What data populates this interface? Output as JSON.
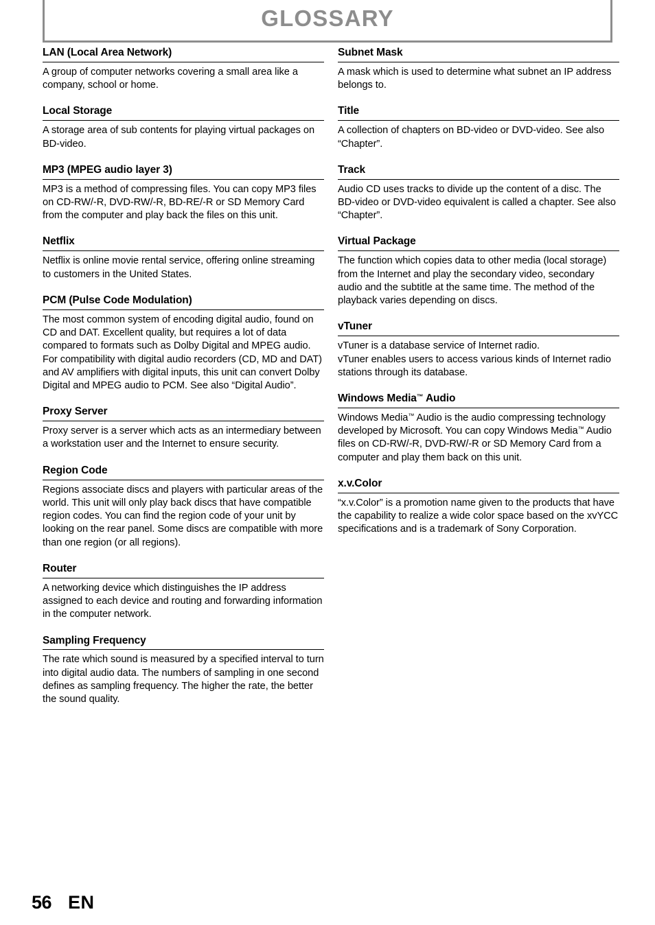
{
  "header": {
    "title": "GLOSSARY"
  },
  "footer": {
    "page_number": "56",
    "language": "EN"
  },
  "columns": {
    "left": [
      {
        "term": "LAN (Local Area Network)",
        "definition": "A group of computer networks covering a small area like a company, school or home."
      },
      {
        "term": "Local Storage",
        "definition": "A storage area of sub contents for playing virtual packages on BD-video."
      },
      {
        "term": "MP3 (MPEG audio layer 3)",
        "definition": "MP3 is a method of compressing files. You can copy MP3 files on CD-RW/-R, DVD-RW/-R, BD-RE/-R or SD Memory Card from the computer and play back the files on this unit."
      },
      {
        "term": "Netflix",
        "definition": "Netflix is online movie rental service, offering online streaming to customers in the United States."
      },
      {
        "term": "PCM (Pulse Code Modulation)",
        "definition": "The most common system of encoding digital audio, found on CD and DAT. Excellent quality, but requires a lot of data compared to formats such as Dolby Digital and MPEG audio. For compatibility with digital audio recorders (CD, MD and DAT) and AV amplifiers with digital inputs, this unit can convert Dolby Digital and MPEG audio to PCM. See also “Digital Audio”."
      },
      {
        "term": "Proxy Server",
        "definition": "Proxy server is a server which acts as an intermediary between a workstation user and the Internet to ensure security."
      },
      {
        "term": "Region Code",
        "definition": "Regions associate discs and players with particular areas of the world. This unit will only play back discs that have compatible region codes. You can find the region code of your unit by looking on the rear panel. Some discs are compatible with more than one region (or all regions)."
      },
      {
        "term": "Router",
        "definition": "A networking device which distinguishes the IP address assigned to each device and routing and forwarding information in the computer network."
      },
      {
        "term": "Sampling Frequency",
        "definition": "The rate which sound is measured by a specified interval to turn into digital audio data. The numbers of sampling in one second defines as sampling frequency. The higher the rate, the better the sound quality."
      }
    ],
    "right": [
      {
        "term": "Subnet Mask",
        "definition": "A mask which is used to determine what subnet an IP address belongs to."
      },
      {
        "term": "Title",
        "definition": "A collection of chapters on BD-video or DVD-video. See also “Chapter”."
      },
      {
        "term": "Track",
        "definition": "Audio CD uses tracks to divide up the content of a disc. The BD-video or DVD-video equivalent is called a chapter. See also “Chapter”."
      },
      {
        "term": "Virtual Package",
        "definition": "The function which copies data to other media (local storage) from the Internet and play the secondary video, secondary audio and the subtitle at the same time. The method of the playback varies depending on discs."
      },
      {
        "term": "vTuner",
        "definition": "vTuner is a database service of Internet radio.\nvTuner enables users to access various kinds of Internet radio stations through its database."
      },
      {
        "term": "Windows Media™ Audio",
        "definition": "Windows Media™ Audio is the audio compressing technology developed by Microsoft. You can copy Windows Media™ Audio files on CD-RW/-R, DVD-RW/-R or SD Memory Card from a computer and play them back on this unit."
      },
      {
        "term": "x.v.Color",
        "definition": "“x.v.Color” is a promotion name given to the products that have the capability to realize a wide color space based on the xvYCC specifications and is a trademark of Sony Corporation."
      }
    ]
  },
  "colors": {
    "header_gray": "#8d8d8d",
    "text_black": "#000000"
  }
}
